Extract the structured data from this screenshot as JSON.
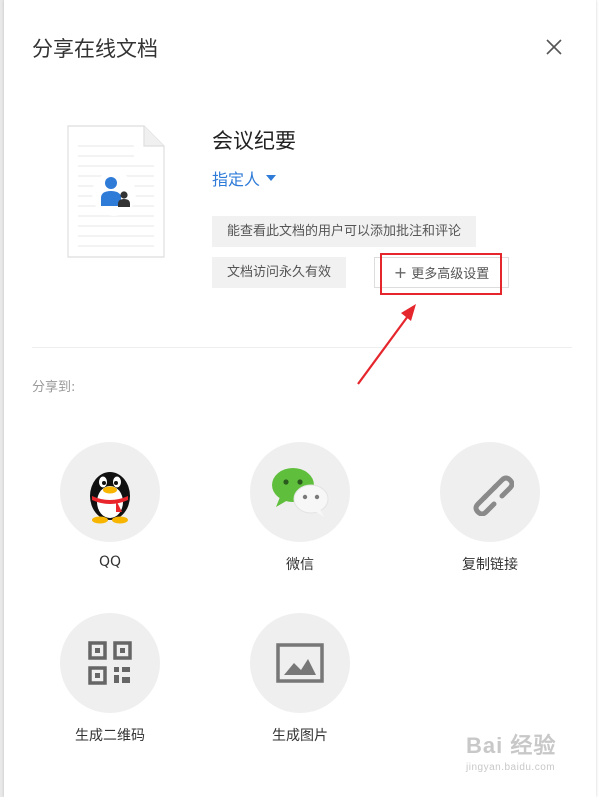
{
  "dialog": {
    "title": "分享在线文档",
    "close_icon": "close-icon"
  },
  "document": {
    "name": "会议纪要",
    "permission": "指定人",
    "permission_icon": "caret-down-icon",
    "thumbnail_icon": "document-users-icon"
  },
  "tags": {
    "comment_permission": "能查看此文档的用户可以添加批注和评论",
    "validity": "文档访问永久有效"
  },
  "advanced": {
    "label": "更多高级设置",
    "icon": "plus-icon"
  },
  "annotation": {
    "highlight_color": "#e5262d"
  },
  "share": {
    "label": "分享到:",
    "items": [
      {
        "label": "QQ",
        "icon": "qq-icon"
      },
      {
        "label": "微信",
        "icon": "wechat-icon"
      },
      {
        "label": "复制链接",
        "icon": "link-icon"
      },
      {
        "label": "生成二维码",
        "icon": "qrcode-icon"
      },
      {
        "label": "生成图片",
        "icon": "image-icon"
      }
    ]
  },
  "watermark": {
    "text": "Bai 经验",
    "url": "jingyan.baidu.com"
  },
  "colors": {
    "accent": "#2f7bd8",
    "tag_bg": "#f1f1f1",
    "circle_bg": "#efefef"
  }
}
